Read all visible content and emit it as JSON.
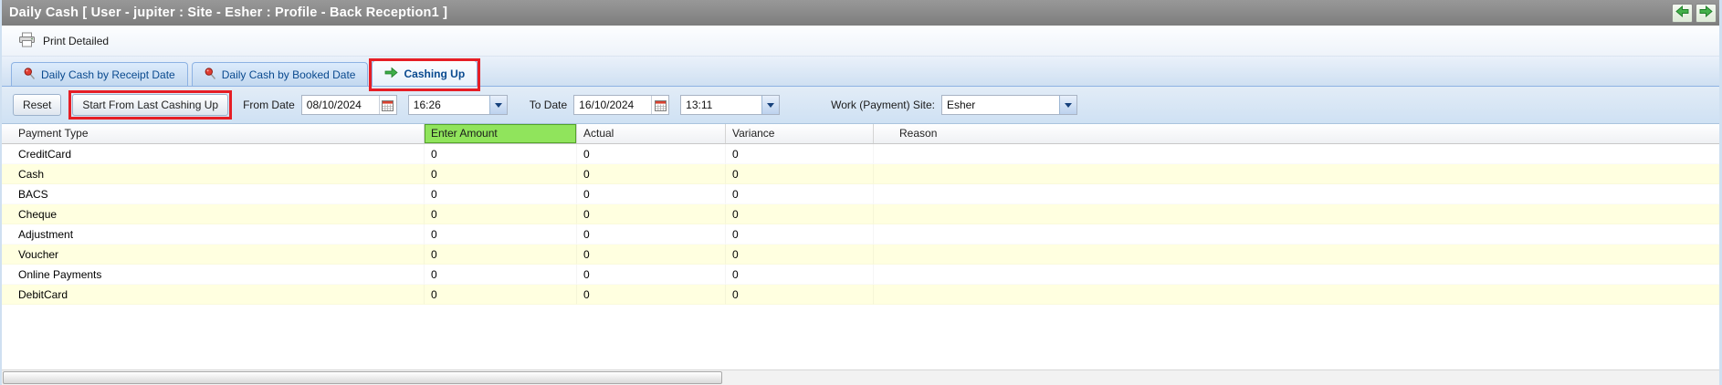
{
  "title_bar": {
    "title": "Daily Cash [ User - jupiter : Site - Esher : Profile - Back Reception1 ]"
  },
  "toolbar": {
    "print_detailed_label": "Print Detailed"
  },
  "tabs": [
    {
      "label": "Daily Cash by Receipt Date",
      "icon": "pin-icon",
      "active": false
    },
    {
      "label": "Daily Cash by Booked Date",
      "icon": "pin-icon",
      "active": false
    },
    {
      "label": "Cashing Up",
      "icon": "cashing-up-icon",
      "active": true
    }
  ],
  "filter_bar": {
    "reset_label": "Reset",
    "start_from_last_label": "Start From Last Cashing Up",
    "from_date_label": "From Date",
    "from_date_value": "08/10/2024",
    "from_time_value": "16:26",
    "to_date_label": "To Date",
    "to_date_value": "16/10/2024",
    "to_time_value": "13:11",
    "site_label": "Work (Payment) Site:",
    "site_value": "Esher"
  },
  "table": {
    "columns": [
      "Payment Type",
      "Enter Amount",
      "Actual",
      "Variance",
      "Reason"
    ],
    "rows": [
      {
        "payment_type": "CreditCard",
        "enter_amount": "0",
        "actual": "0",
        "variance": "0",
        "reason": ""
      },
      {
        "payment_type": "Cash",
        "enter_amount": "0",
        "actual": "0",
        "variance": "0",
        "reason": ""
      },
      {
        "payment_type": "BACS",
        "enter_amount": "0",
        "actual": "0",
        "variance": "0",
        "reason": ""
      },
      {
        "payment_type": "Cheque",
        "enter_amount": "0",
        "actual": "0",
        "variance": "0",
        "reason": ""
      },
      {
        "payment_type": "Adjustment",
        "enter_amount": "0",
        "actual": "0",
        "variance": "0",
        "reason": ""
      },
      {
        "payment_type": "Voucher",
        "enter_amount": "0",
        "actual": "0",
        "variance": "0",
        "reason": ""
      },
      {
        "payment_type": "Online Payments",
        "enter_amount": "0",
        "actual": "0",
        "variance": "0",
        "reason": ""
      },
      {
        "payment_type": "DebitCard",
        "enter_amount": "0",
        "actual": "0",
        "variance": "0",
        "reason": ""
      }
    ]
  },
  "icons": {
    "printer": "printer-icon",
    "tab_pin": "pin-icon (red pushpin)",
    "cashing_up": "cashing-up-icon (green arrow)",
    "calendar": "calendar-icon",
    "dropdown": "chevron-down-icon",
    "nav_back": "arrow-left-icon (green)",
    "nav_forward": "arrow-right-icon (green)"
  },
  "colors": {
    "title_bar_gray": "#868686",
    "enter_amount_highlight": "#90e45c",
    "annotation_red": "#e61e25",
    "row_alt_yellow": "#ffffe0",
    "tab_text_blue": "#0a4a8f"
  }
}
